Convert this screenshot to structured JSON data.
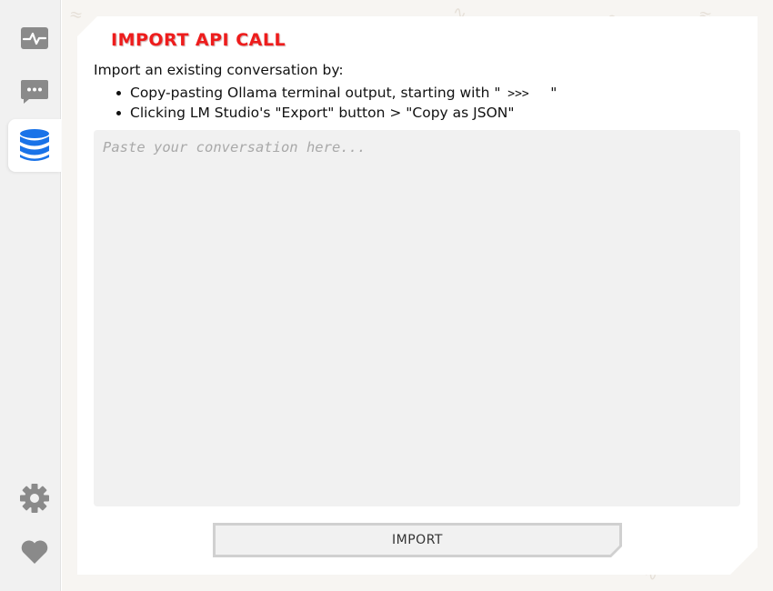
{
  "sidebar": {
    "items": [
      {
        "icon": "activity-icon",
        "active": false
      },
      {
        "icon": "chat-icon",
        "active": false
      },
      {
        "icon": "database-icon",
        "active": true
      },
      {
        "icon": "gear-icon",
        "active": false
      },
      {
        "icon": "heart-icon",
        "active": false
      }
    ]
  },
  "panel": {
    "title": "IMPORT API CALL",
    "intro": "Import an existing conversation by:",
    "bullets": {
      "ollama_prefix": "Copy-pasting Ollama terminal output, starting with \"",
      "ollama_prompt": " >>>   ",
      "ollama_suffix": "\"",
      "lmstudio": "Clicking LM Studio's \"Export\" button > \"Copy as JSON\""
    },
    "input": {
      "placeholder": "Paste your conversation here...",
      "value": ""
    },
    "import_button": "IMPORT"
  },
  "colors": {
    "title_red": "#ee1c1c",
    "active_icon_blue": "#1a73e8",
    "inactive_icon_gray": "#8a8a8a"
  }
}
